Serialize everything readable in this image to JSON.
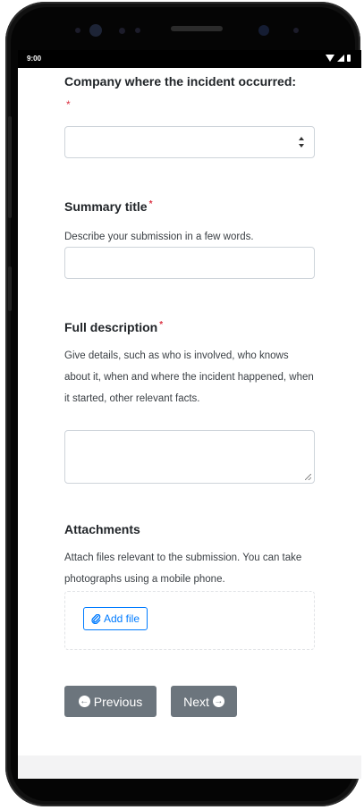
{
  "status_bar": {
    "time": "9:00"
  },
  "form": {
    "company": {
      "label": "Company where the incident occurred:",
      "required_mark": "*",
      "selected": ""
    },
    "summary": {
      "label": "Summary title",
      "required_mark": "*",
      "help": "Describe your submission in a few words.",
      "value": ""
    },
    "description": {
      "label": "Full description",
      "required_mark": "*",
      "help": "Give details, such as who is involved, who knows about it, when and where the incident happened, when it started, other relevant facts.",
      "value": ""
    },
    "attachments": {
      "label": "Attachments",
      "help": "Attach files relevant to the submission. You can take photographs using a mobile phone.",
      "add_file_label": "Add file",
      "add_file_icon": "paperclip-icon"
    },
    "navigation": {
      "previous_label": "Previous",
      "previous_icon": "arrow-circle-left-icon",
      "next_label": "Next",
      "next_icon": "arrow-circle-right-icon"
    }
  },
  "colors": {
    "required": "#dc3545",
    "link_primary": "#007bff",
    "nav_button": "#6c757d"
  }
}
